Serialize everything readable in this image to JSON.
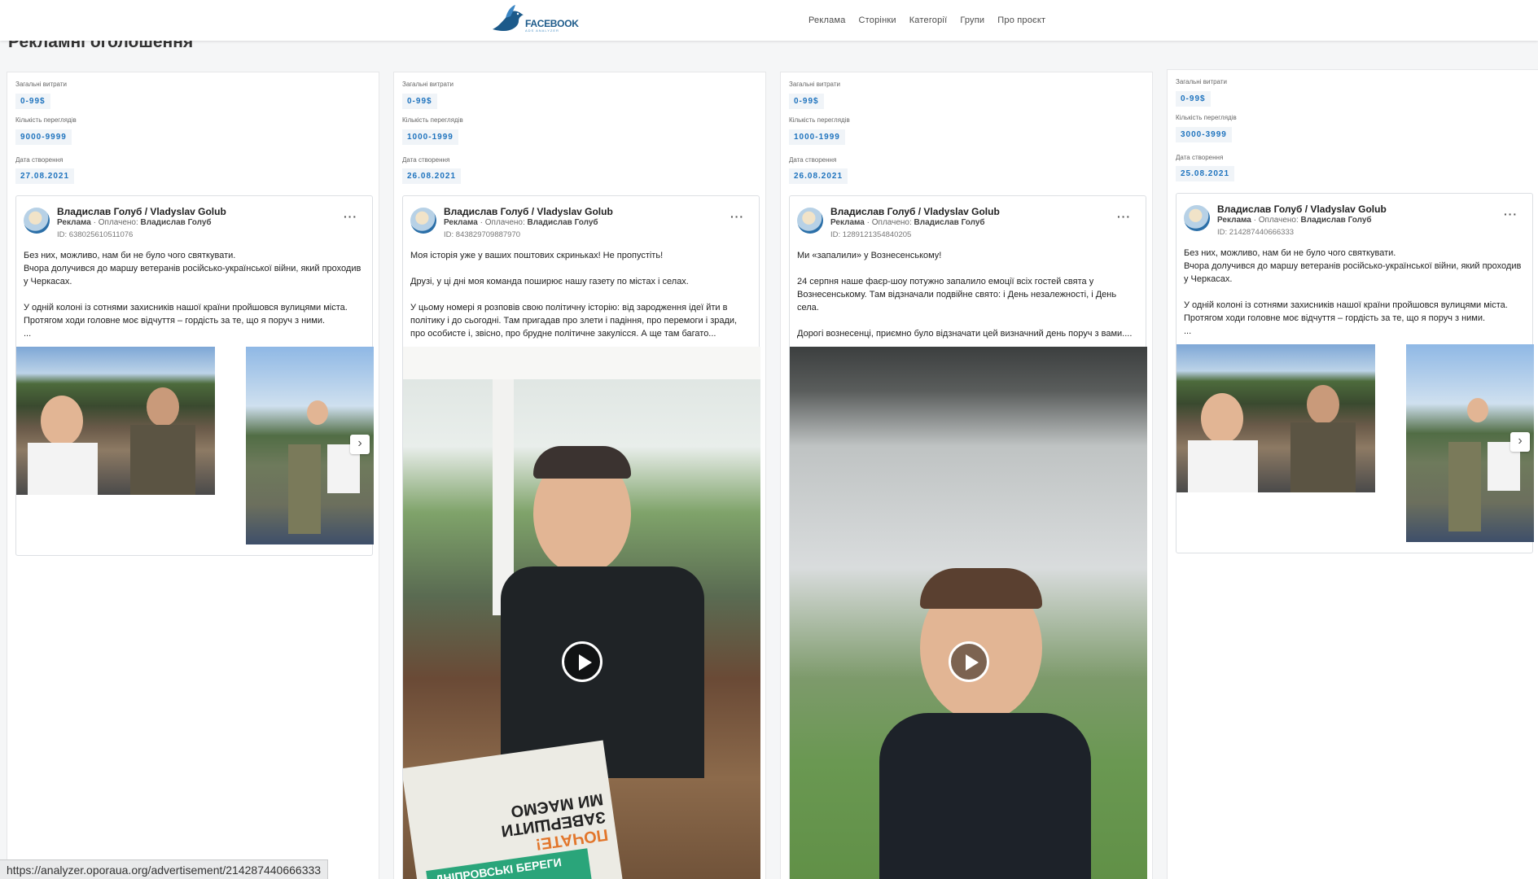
{
  "header": {
    "logo_text": "FACEBOOK",
    "logo_sub": "ADS ANALYZER",
    "nav": [
      "Реклама",
      "Сторінки",
      "Категорії",
      "Групи",
      "Про проєкт"
    ]
  },
  "page_title": "Рекламні оголошення",
  "labels": {
    "spend": "Загальні витрати",
    "views": "Кількість переглядів",
    "created": "Дата створення",
    "ad_tag": "Реклама",
    "paid_prefix": "· Оплачено:",
    "id_prefix": "ID:"
  },
  "ads": [
    {
      "spend": "0-99$",
      "views": "9000-9999",
      "date": "27.08.2021",
      "author": "Владислав Голуб / Vladyslav Golub",
      "paid_by": "Владислав Голуб",
      "id": "638025610511076",
      "text": "Без них, можливо, нам би не було чого святкувати.\nВчора долучився до маршу ветеранів російсько-української війни, який проходив у Черкасах.\n\nУ одній колоні із сотнями захисників нашої країни пройшовся вулицями міста.\nПротягом ходи головне моє відчуття – гордість за те, що я поруч з ними.\n..."
    },
    {
      "spend": "0-99$",
      "views": "1000-1999",
      "date": "26.08.2021",
      "author": "Владислав Голуб / Vladyslav Golub",
      "paid_by": "Владислав Голуб",
      "id": "843829709887970",
      "text": "Моя історія уже у ваших поштових скриньках! Не пропустіть!\n\nДрузі, у ці дні моя команда поширює нашу газету по містах і селах.\n\nУ цьому номері я розповів свою політичну історію: від зародження ідеї йти в політику і до сьогодні. Там пригадав про злети і падіння, про перемоги і зради, про особисте і, звісно, про брудне політичне закулісся. А ще там багато..."
    },
    {
      "spend": "0-99$",
      "views": "1000-1999",
      "date": "26.08.2021",
      "author": "Владислав Голуб / Vladyslav Golub",
      "paid_by": "Владислав Голуб",
      "id": "1289121354840205",
      "text": "Ми «запалили» у Вознесенському!\n\n24 серпня наше фаєр-шоу потужно запалило емоції всіх гостей свята у Вознесенському. Там відзначали подвійне свято: і День незалежності, і День села.\n\nДорогі вознесенці, приємно було відзначати цей визначний день поруч з вами...."
    },
    {
      "spend": "0-99$",
      "views": "3000-3999",
      "date": "25.08.2021",
      "author": "Владислав Голуб / Vladyslav Golub",
      "paid_by": "Владислав Голуб",
      "id": "214287440666333",
      "text": "Без них, можливо, нам би не було чого святкувати.\nВчора долучився до маршу ветеранів російсько-української війни, який проходив у Черкасах.\n\nУ одній колоні із сотнями захисників нашої країни пройшовся вулицями міста.\nПротягом ходи головне моє відчуття – гордість за те, що я поруч з ними.\n..."
    }
  ],
  "newspaper": {
    "line1": "МИ МАЄМО",
    "line2": "ЗАВЕРШИТИ",
    "line3": "ПОЧАТЕ!",
    "line4": "ДНІПРОВСЬКІ",
    "line5": "БЕРЕГИ"
  },
  "status_url": "https://analyzer.oporaua.org/advertisement/214287440666333"
}
